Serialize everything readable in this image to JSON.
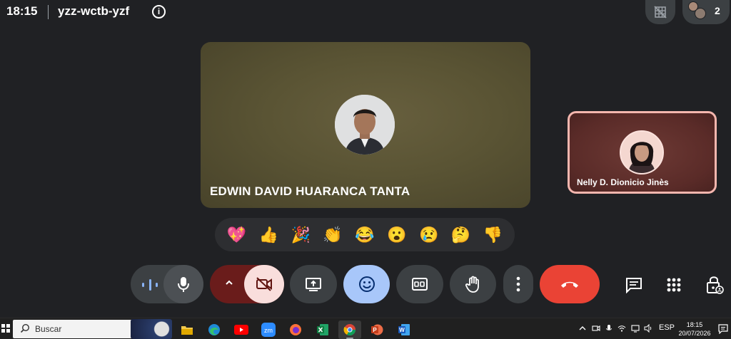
{
  "meeting": {
    "time": "18:15",
    "code": "yzz-wctb-yzf",
    "participant_count": "2"
  },
  "main_tile": {
    "name": "EDWIN DAVID HUARANCA TANTA"
  },
  "self_tile": {
    "name": "Nelly D. Dionicio Jinès"
  },
  "reactions": [
    "💖",
    "👍",
    "🎉",
    "👏",
    "😂",
    "😮",
    "😢",
    "🤔",
    "👎"
  ],
  "controls": {
    "mic": "microphone-on",
    "camera": "camera-off",
    "emoji_active": true
  },
  "colors": {
    "background": "#202124",
    "hangup": "#ea4335",
    "emoji_active": "#a8c7fa",
    "camera_off": "#f9dedc",
    "self_border": "#f4b6ae"
  },
  "taskbar": {
    "search_placeholder": "Buscar",
    "apps": [
      "file-explorer",
      "edge",
      "youtube",
      "zoom",
      "firefox",
      "excel",
      "chrome",
      "powerpoint",
      "word"
    ],
    "apps_labels": {
      "zoom": "zm"
    },
    "language": "ESP",
    "clock_time": "18:15",
    "clock_date": "20/07/2026"
  }
}
